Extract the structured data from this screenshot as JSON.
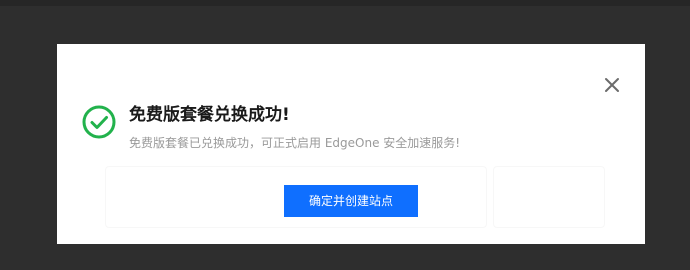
{
  "dialog": {
    "title": "免费版套餐兑换成功!",
    "message": "免费版套餐已兑换成功，可正式启用 EdgeOne 安全加速服务!",
    "primary_button_label": "确定并创建站点",
    "status_icon": "success-check-icon",
    "close_icon": "close-icon"
  },
  "colors": {
    "success": "#22b24c",
    "primary": "#0f6fff",
    "overlay": "#2e2e2e"
  }
}
